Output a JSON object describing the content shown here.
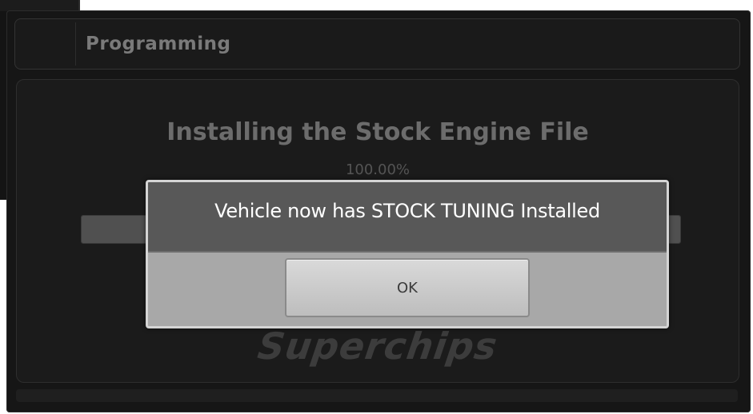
{
  "header": {
    "title": "Programming"
  },
  "install": {
    "title": "Installing the Stock Engine File",
    "progress_text": "100.00%",
    "progress_fraction": 1.0
  },
  "brand": {
    "logo_text": "Superchips"
  },
  "dialog": {
    "message": "Vehicle now has STOCK TUNING Installed",
    "ok_label": "OK"
  },
  "colors": {
    "screen_background": "#161616",
    "dialog_header": "#585858",
    "dialog_body": "#a8a8a8"
  }
}
